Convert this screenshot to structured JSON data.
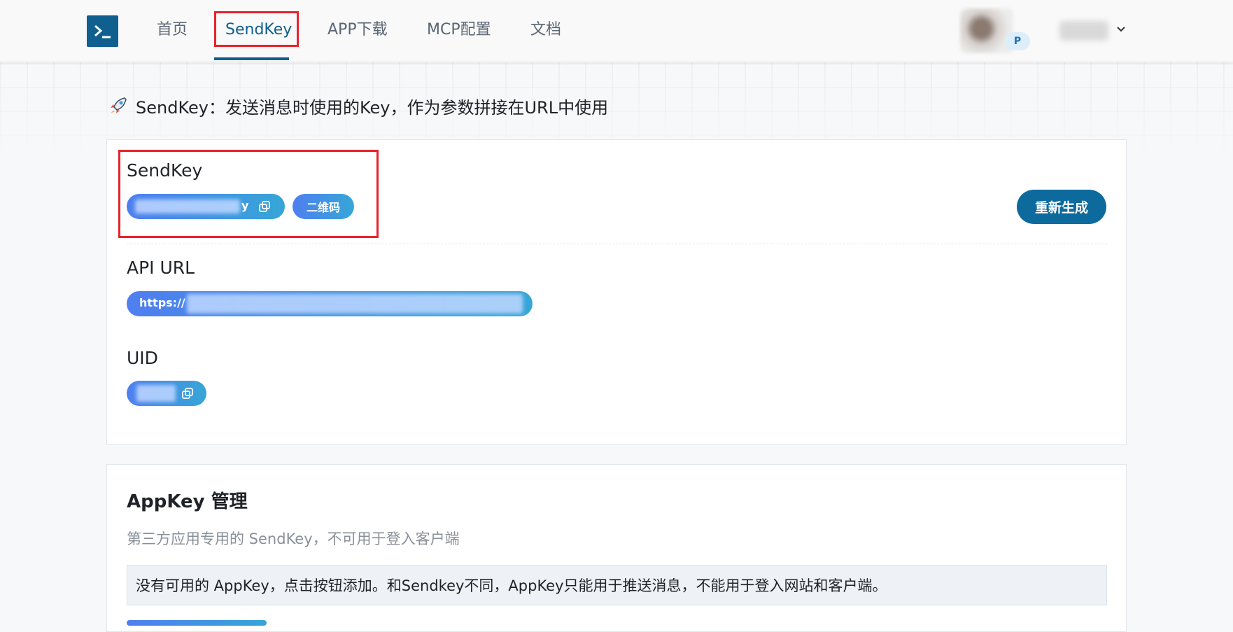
{
  "nav": {
    "items": [
      "首页",
      "SendKey",
      "APP下载",
      "MCP配置",
      "文档"
    ],
    "active_index": 1,
    "badge": "P"
  },
  "page": {
    "heading": "SendKey：发送消息时使用的Key，作为参数拼接在URL中使用"
  },
  "sendkey_card": {
    "sendkey_label": "SendKey",
    "sendkey_value_tail": "y",
    "qr_button": "二维码",
    "regen_button": "重新生成",
    "api_url_label": "API URL",
    "api_url_prefix": "https://",
    "uid_label": "UID"
  },
  "appkey_card": {
    "title": "AppKey 管理",
    "subtitle": "第三方应用专用的 SendKey，不可用于登入客户端",
    "notice": "没有可用的 AppKey，点击按钮添加。和Sendkey不同，AppKey只能用于推送消息，不能用于登入网站和客户端。"
  },
  "colors": {
    "brand": "#0f5f8f",
    "highlight": "#e8222b",
    "pill_start": "#4f7ff0",
    "pill_end": "#36a6d6"
  }
}
